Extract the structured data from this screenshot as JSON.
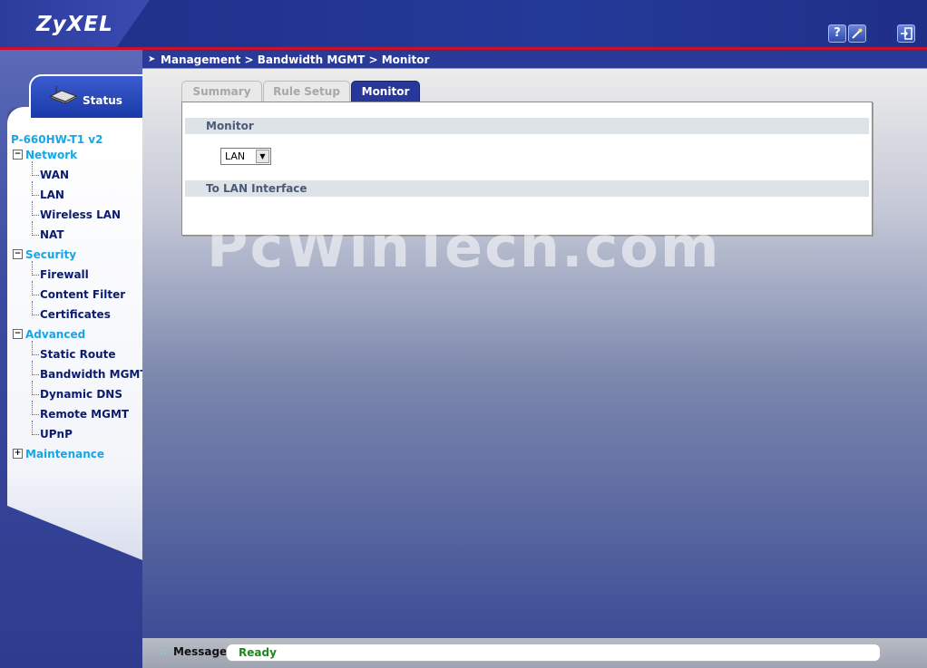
{
  "header": {
    "logo": "ZyXEL",
    "help_icon": "?",
    "wizard_icon": "wand",
    "logout_icon": "logout"
  },
  "breadcrumb": "Management > Bandwidth MGMT > Monitor",
  "sidebar": {
    "status_label": "Status",
    "device": "P-660HW-T1 v2",
    "categories": [
      {
        "label": "Network",
        "expander": "−",
        "items": [
          "WAN",
          "LAN",
          "Wireless LAN",
          "NAT"
        ]
      },
      {
        "label": "Security",
        "expander": "−",
        "items": [
          "Firewall",
          "Content Filter",
          "Certificates"
        ]
      },
      {
        "label": "Advanced",
        "expander": "−",
        "items": [
          "Static Route",
          "Bandwidth MGMT",
          "Dynamic DNS",
          "Remote MGMT",
          "UPnP"
        ]
      },
      {
        "label": "Maintenance",
        "expander": "+",
        "items": []
      }
    ]
  },
  "tabs": [
    {
      "label": "Summary",
      "active": false
    },
    {
      "label": "Rule Setup",
      "active": false
    },
    {
      "label": "Monitor",
      "active": true
    }
  ],
  "panel": {
    "monitor_heading": "Monitor",
    "interface_select": {
      "value": "LAN"
    },
    "to_interface_heading": "To LAN Interface"
  },
  "watermark": "PcWinTech.com",
  "footer": {
    "message_label": "Message",
    "message_value": "Ready"
  },
  "colors": {
    "accent": "#28379a",
    "category": "#16a6e8",
    "ready": "#1a8a1a",
    "header_red": "#c8102e"
  }
}
